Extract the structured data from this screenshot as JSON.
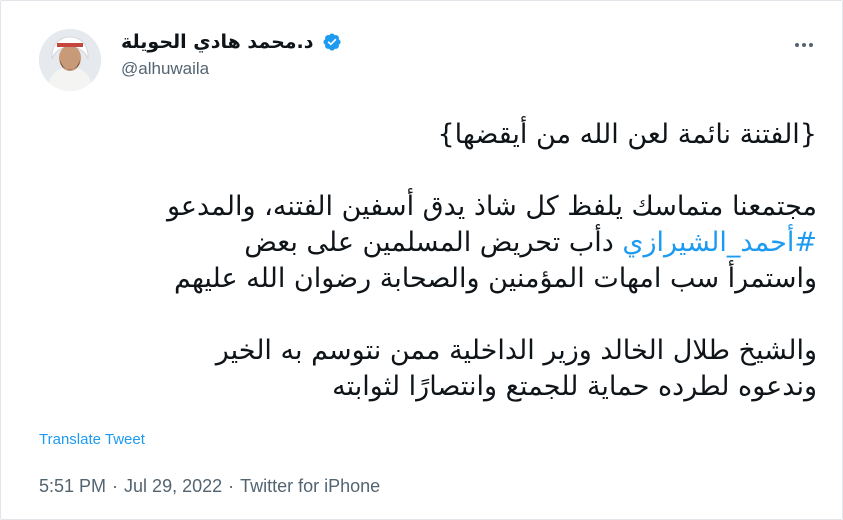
{
  "author": {
    "display_name": "د.محمد هادي الحويلة",
    "handle": "@alhuwaila",
    "verified": true
  },
  "tweet": {
    "lines": [
      "{الفتنة نائمة لعن الله من أيقضها}",
      "",
      "مجتمعنا متماسك يلفظ كل شاذ يدق أسفين الفتنه، والمدعو",
      {
        "hashtag": "#أحمد_الشيرازي",
        "text": " دأب تحريض المسلمين على بعض"
      },
      "واستمرأ سب امهات المؤمنين والصحابة رضوان الله عليهم",
      "",
      "والشيخ طلال الخالد وزير الداخلية ممن نتوسم به الخير",
      "وندعوه لطرده حماية للجمتع وانتصارًا لثوابته"
    ],
    "translate_label": "Translate Tweet",
    "time": "5:51 PM",
    "separator": "·",
    "date": "Jul 29, 2022",
    "source": "Twitter for iPhone"
  },
  "icons": {
    "verified": "verified-badge-icon",
    "more": "more-options-icon"
  },
  "colors": {
    "link": "#1d9bf0",
    "text": "#0f1419",
    "muted": "#536471"
  }
}
